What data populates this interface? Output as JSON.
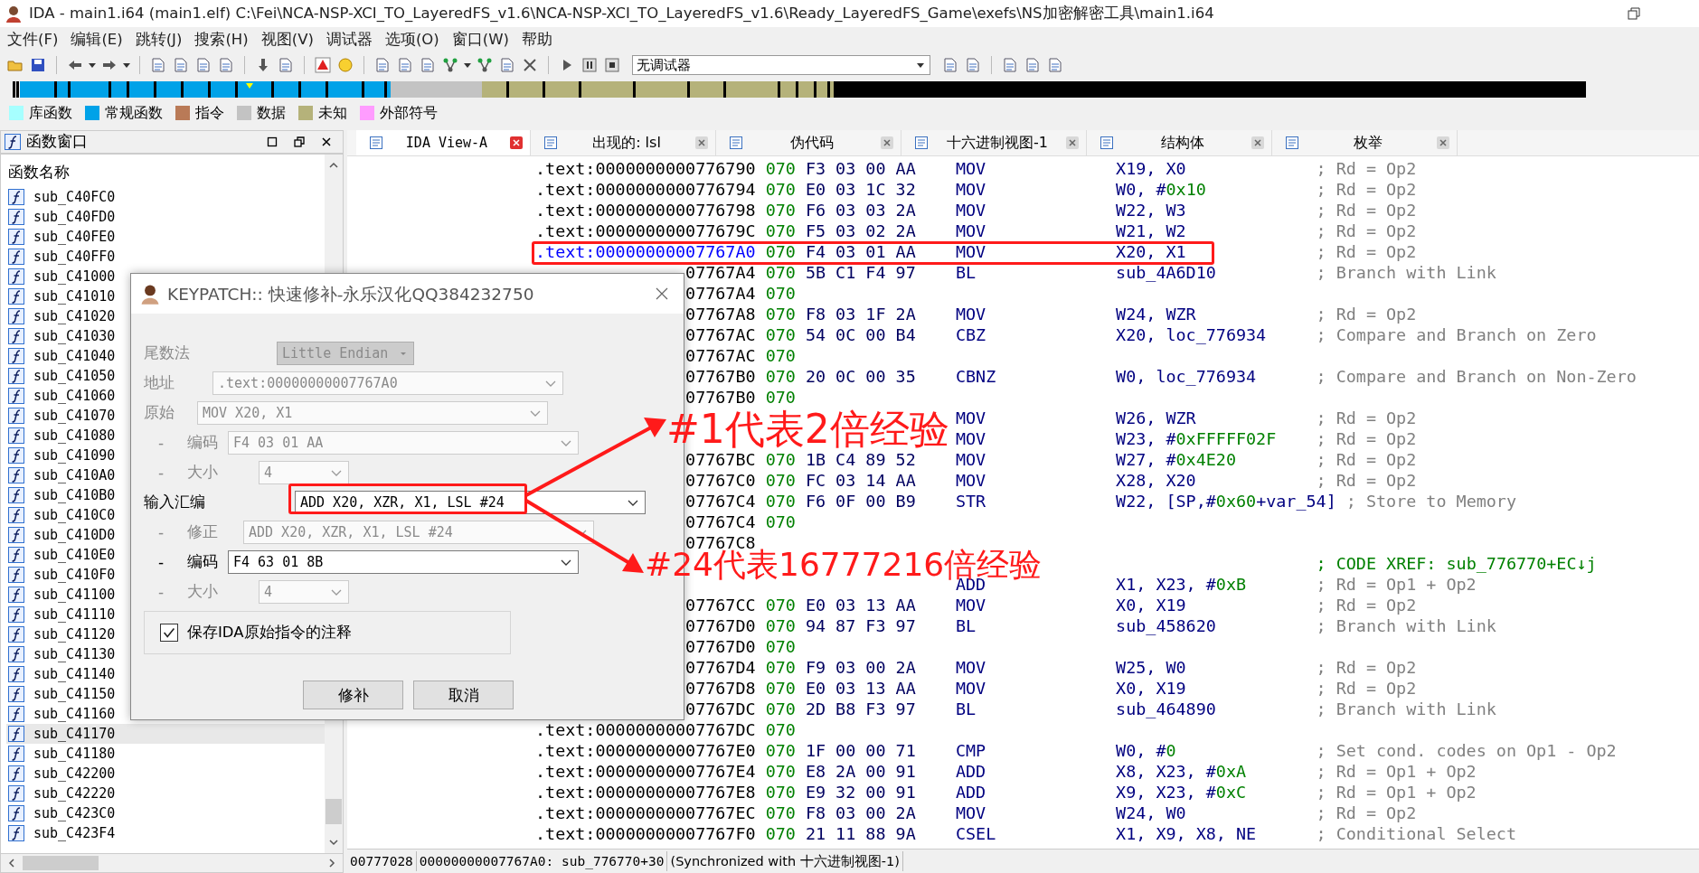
{
  "window": {
    "title": "IDA - main1.i64 (main1.elf) C:\\Fei\\NCA-NSP-XCI_TO_LayeredFS_v1.6\\NCA-NSP-XCI_TO_LayeredFS_v1.6\\Ready_LayeredFS_Game\\exefs\\NS加密解密工具\\main1.i64"
  },
  "menu": [
    "文件(F)",
    "编辑(E)",
    "跳转(J)",
    "搜索(H)",
    "视图(V)",
    "调试器",
    "选项(O)",
    "窗口(W)",
    "帮助"
  ],
  "toolbar": {
    "debugger": "无调试器"
  },
  "legend": [
    {
      "label": "库函数",
      "color": "#a6ffff"
    },
    {
      "label": "常规函数",
      "color": "#00a2e8"
    },
    {
      "label": "指令",
      "color": "#b97a57"
    },
    {
      "label": "数据",
      "color": "#c3c3c3"
    },
    {
      "label": "未知",
      "color": "#b5b27a"
    },
    {
      "label": "外部符号",
      "color": "#ff9cff"
    }
  ],
  "functions_panel": {
    "title": "函数窗口",
    "column": "函数名称",
    "items": [
      {
        "name": "sub_C40FC0",
        "selected": false
      },
      {
        "name": "sub_C40FD0",
        "selected": false
      },
      {
        "name": "sub_C40FE0",
        "selected": false
      },
      {
        "name": "sub_C40FF0",
        "selected": false
      },
      {
        "name": "sub_C41000",
        "selected": false
      },
      {
        "name": "sub_C41010",
        "selected": false
      },
      {
        "name": "sub_C41020",
        "selected": false
      },
      {
        "name": "sub_C41030",
        "selected": false
      },
      {
        "name": "sub_C41040",
        "selected": false
      },
      {
        "name": "sub_C41050",
        "selected": false
      },
      {
        "name": "sub_C41060",
        "selected": false
      },
      {
        "name": "sub_C41070",
        "selected": false
      },
      {
        "name": "sub_C41080",
        "selected": false
      },
      {
        "name": "sub_C41090",
        "selected": false
      },
      {
        "name": "sub_C410A0",
        "selected": false
      },
      {
        "name": "sub_C410B0",
        "selected": false
      },
      {
        "name": "sub_C410C0",
        "selected": false
      },
      {
        "name": "sub_C410D0",
        "selected": false
      },
      {
        "name": "sub_C410E0",
        "selected": false
      },
      {
        "name": "sub_C410F0",
        "selected": false
      },
      {
        "name": "sub_C41100",
        "selected": false
      },
      {
        "name": "sub_C41110",
        "selected": false
      },
      {
        "name": "sub_C41120",
        "selected": false
      },
      {
        "name": "sub_C41130",
        "selected": false
      },
      {
        "name": "sub_C41140",
        "selected": false
      },
      {
        "name": "sub_C41150",
        "selected": false
      },
      {
        "name": "sub_C41160",
        "selected": false
      },
      {
        "name": "sub_C41170",
        "selected": true
      },
      {
        "name": "sub_C41180",
        "selected": false
      },
      {
        "name": "sub_C42200",
        "selected": false
      },
      {
        "name": "sub_C42220",
        "selected": false
      },
      {
        "name": "sub_C423C0",
        "selected": false
      },
      {
        "name": "sub_C423F4",
        "selected": false
      }
    ]
  },
  "tabs": [
    {
      "label": "IDA View-A",
      "selected": true
    },
    {
      "label": "出现的: lsl",
      "selected": false
    },
    {
      "label": "伪代码",
      "selected": false
    },
    {
      "label": "十六进制视图-1",
      "selected": false
    },
    {
      "label": "结构体",
      "selected": false
    },
    {
      "label": "枚举",
      "selected": false
    }
  ],
  "listing": {
    "rows": [
      {
        "kind": "instr",
        "address": ".text:0000000000776790",
        "segment": "070",
        "bytes": "F3 03 00 AA",
        "mnemonic": "MOV",
        "operands": [
          {
            "text": "X19, X0",
            "kind": "reg"
          }
        ],
        "comment": "; Rd = Op2",
        "selected": false
      },
      {
        "kind": "instr",
        "address": ".text:0000000000776794",
        "segment": "070",
        "bytes": "E0 03 1C 32",
        "mnemonic": "MOV",
        "operands": [
          {
            "text": "W0, #",
            "kind": "reg"
          },
          {
            "text": "0x10",
            "kind": "number"
          }
        ],
        "comment": "; Rd = Op2",
        "selected": false
      },
      {
        "kind": "instr",
        "address": ".text:0000000000776798",
        "segment": "070",
        "bytes": "F6 03 03 2A",
        "mnemonic": "MOV",
        "operands": [
          {
            "text": "W22, W3",
            "kind": "reg"
          }
        ],
        "comment": "; Rd = Op2",
        "selected": false
      },
      {
        "kind": "instr",
        "address": ".text:000000000077679C",
        "segment": "070",
        "bytes": "F5 03 02 2A",
        "mnemonic": "MOV",
        "operands": [
          {
            "text": "W21, W2",
            "kind": "reg"
          }
        ],
        "comment": "; Rd = Op2",
        "selected": false
      },
      {
        "kind": "instr",
        "address": ".text:00000000007767A0",
        "segment": "070",
        "bytes": "F4 03 01 AA",
        "mnemonic": "MOV",
        "operands": [
          {
            "text": "X20, X1",
            "kind": "reg"
          }
        ],
        "comment": "; Rd = Op2",
        "selected": true
      },
      {
        "kind": "instr",
        "address": "07767A4",
        "segment": "070",
        "bytes": "5B C1 F4 97",
        "mnemonic": "BL",
        "operands": [
          {
            "text": "sub_4A6D10",
            "kind": "reg"
          }
        ],
        "comment": "; Branch with Link",
        "selected": false
      },
      {
        "kind": "addr",
        "address": "07767A4",
        "segment": "070",
        "selected": false
      },
      {
        "kind": "instr",
        "address": "07767A8",
        "segment": "070",
        "bytes": "F8 03 1F 2A",
        "mnemonic": "MOV",
        "operands": [
          {
            "text": "W24, WZR",
            "kind": "reg"
          }
        ],
        "comment": "; Rd = Op2",
        "selected": false
      },
      {
        "kind": "instr",
        "address": "07767AC",
        "segment": "070",
        "bytes": "54 0C 00 B4",
        "mnemonic": "CBZ",
        "operands": [
          {
            "text": "X20, loc_776934",
            "kind": "reg"
          }
        ],
        "comment": "; Compare and Branch on Zero",
        "selected": false
      },
      {
        "kind": "addr",
        "address": "07767AC",
        "segment": "070",
        "selected": false
      },
      {
        "kind": "instr",
        "address": "07767B0",
        "segment": "070",
        "bytes": "20 0C 00 35",
        "mnemonic": "CBNZ",
        "operands": [
          {
            "text": "W0, loc_776934",
            "kind": "reg"
          }
        ],
        "comment": "; Compare and Branch on Non-Zero",
        "selected": false
      },
      {
        "kind": "addr",
        "address": "07767B0",
        "segment": "070",
        "selected": false
      },
      {
        "kind": "instr",
        "mnemonic": "MOV",
        "operands": [
          {
            "text": "W26, WZR",
            "kind": "reg"
          }
        ],
        "comment": "; Rd = Op2"
      },
      {
        "kind": "instr",
        "mnemonic": "MOV",
        "operands": [
          {
            "text": "W23, #",
            "kind": "reg"
          },
          {
            "text": "0xFFFFF02F",
            "kind": "number"
          }
        ],
        "comment": "; Rd = Op2"
      },
      {
        "kind": "instr",
        "address": "07767BC",
        "segment": "070",
        "bytes": "1B C4 89 52",
        "mnemonic": "MOV",
        "operands": [
          {
            "text": "W27, #",
            "kind": "reg"
          },
          {
            "text": "0x4E20",
            "kind": "number"
          }
        ],
        "comment": "; Rd = Op2",
        "selected": false
      },
      {
        "kind": "instr",
        "address": "07767C0",
        "segment": "070",
        "bytes": "FC 03 14 AA",
        "mnemonic": "MOV",
        "operands": [
          {
            "text": "X28, X20",
            "kind": "reg"
          }
        ],
        "comment": "; Rd = Op2",
        "selected": false
      },
      {
        "kind": "instr",
        "address": "07767C4",
        "segment": "070",
        "bytes": "F6 0F 00 B9",
        "mnemonic": "STR",
        "operands": [
          {
            "text": "W22, [SP,#",
            "kind": "reg"
          },
          {
            "text": "0x60",
            "kind": "number"
          },
          {
            "text": "+var_54]",
            "kind": "reg"
          }
        ],
        "comment": "; Store to Memory",
        "selected": false
      },
      {
        "kind": "addr",
        "address": "07767C4",
        "segment": "070",
        "selected": false
      },
      {
        "kind": "empty",
        "address": "07767C8",
        "selected": false
      },
      {
        "kind": "label",
        "comment": "; CODE XREF: sub_776770+EC↓j"
      },
      {
        "kind": "instr",
        "mnemonic": "ADD",
        "operands": [
          {
            "text": "X1, X23, #",
            "kind": "reg"
          },
          {
            "text": "0xB",
            "kind": "number"
          }
        ],
        "comment": "; Rd = Op1 + Op2"
      },
      {
        "kind": "instr",
        "address": "07767CC",
        "segment": "070",
        "bytes": "E0 03 13 AA",
        "mnemonic": "MOV",
        "operands": [
          {
            "text": "X0, X19",
            "kind": "reg"
          }
        ],
        "comment": "; Rd = Op2",
        "selected": false
      },
      {
        "kind": "instr",
        "address": "07767D0",
        "segment": "070",
        "bytes": "94 87 F3 97",
        "mnemonic": "BL",
        "operands": [
          {
            "text": "sub_458620",
            "kind": "reg"
          }
        ],
        "comment": "; Branch with Link",
        "selected": false
      },
      {
        "kind": "addr",
        "address": "07767D0",
        "segment": "070",
        "selected": false
      },
      {
        "kind": "instr",
        "address": "07767D4",
        "segment": "070",
        "bytes": "F9 03 00 2A",
        "mnemonic": "MOV",
        "operands": [
          {
            "text": "W25, W0",
            "kind": "reg"
          }
        ],
        "comment": "; Rd = Op2",
        "selected": false
      },
      {
        "kind": "instr",
        "address": "07767D8",
        "segment": "070",
        "bytes": "E0 03 13 AA",
        "mnemonic": "MOV",
        "operands": [
          {
            "text": "X0, X19",
            "kind": "reg"
          }
        ],
        "comment": "; Rd = Op2",
        "selected": false
      },
      {
        "kind": "instr",
        "address": "07767DC",
        "segment": "070",
        "bytes": "2D B8 F3 97",
        "mnemonic": "BL",
        "operands": [
          {
            "text": "sub_464890",
            "kind": "reg"
          }
        ],
        "comment": "; Branch with Link",
        "selected": false
      },
      {
        "kind": "addr",
        "address": ".text:00000000007767DC",
        "segment": "070",
        "selected": false
      },
      {
        "kind": "instr",
        "address": ".text:00000000007767E0",
        "segment": "070",
        "bytes": "1F 00 00 71",
        "mnemonic": "CMP",
        "operands": [
          {
            "text": "W0, #",
            "kind": "reg"
          },
          {
            "text": "0",
            "kind": "number"
          }
        ],
        "comment": "; Set cond. codes on Op1 - Op2",
        "selected": false
      },
      {
        "kind": "instr",
        "address": ".text:00000000007767E4",
        "segment": "070",
        "bytes": "E8 2A 00 91",
        "mnemonic": "ADD",
        "operands": [
          {
            "text": "X8, X23, #",
            "kind": "reg"
          },
          {
            "text": "0xA",
            "kind": "number"
          }
        ],
        "comment": "; Rd = Op1 + Op2",
        "selected": false
      },
      {
        "kind": "instr",
        "address": ".text:00000000007767E8",
        "segment": "070",
        "bytes": "E9 32 00 91",
        "mnemonic": "ADD",
        "operands": [
          {
            "text": "X9, X23, #",
            "kind": "reg"
          },
          {
            "text": "0xC",
            "kind": "number"
          }
        ],
        "comment": "; Rd = Op1 + Op2",
        "selected": false
      },
      {
        "kind": "instr",
        "address": ".text:00000000007767EC",
        "segment": "070",
        "bytes": "F8 03 00 2A",
        "mnemonic": "MOV",
        "operands": [
          {
            "text": "W24, W0",
            "kind": "reg"
          }
        ],
        "comment": "; Rd = Op2",
        "selected": false
      },
      {
        "kind": "instr",
        "address": ".text:00000000007767F0",
        "segment": "070",
        "bytes": "21 11 88 9A",
        "mnemonic": "CSEL",
        "operands": [
          {
            "text": "X1, X9, X8, NE",
            "kind": "reg"
          }
        ],
        "comment": "; Conditional Select",
        "selected": false
      }
    ]
  },
  "status_bar": [
    "00777028",
    "00000000007767A0: sub_776770+30",
    "(Synchronized with 十六进制视图-1)"
  ],
  "dialog": {
    "title": "KEYPATCH:: 快速修补-永乐汉化QQ384232750",
    "fields": [
      {
        "label": "尾数法",
        "value": "Little Endian",
        "kind": "select",
        "disabled": true
      },
      {
        "label": "地址",
        "value": ".text:00000000007767A0",
        "kind": "combo",
        "disabled": true
      },
      {
        "label": "原始",
        "value": "MOV X20, X1",
        "kind": "combo",
        "disabled": true
      },
      {
        "prefix": "-",
        "label": "编码",
        "value": "F4 03 01 AA",
        "kind": "combo",
        "disabled": true
      },
      {
        "prefix": "-",
        "label": "大小",
        "value": "4",
        "kind": "short",
        "disabled": true
      },
      {
        "label": "输入汇编",
        "value": "ADD X20, XZR, X1, LSL #24",
        "kind": "combo",
        "disabled": false
      },
      {
        "prefix": "-",
        "label": "修正",
        "value": "ADD X20, XZR, X1, LSL #24",
        "kind": "combo",
        "disabled": true
      },
      {
        "prefix": "-",
        "label": "编码",
        "value": "F4 63 01 8B",
        "kind": "combo",
        "disabled": false
      },
      {
        "prefix": "-",
        "label": "大小",
        "value": "4",
        "kind": "short",
        "disabled": true
      }
    ],
    "checkbox": {
      "label": "保存IDA原始指令的注释",
      "checked": true
    },
    "buttons": [
      "修补",
      "取消"
    ]
  },
  "annotations": [
    {
      "text": "#1代表2倍经验"
    },
    {
      "text": "#24代表16777216倍经验"
    }
  ]
}
